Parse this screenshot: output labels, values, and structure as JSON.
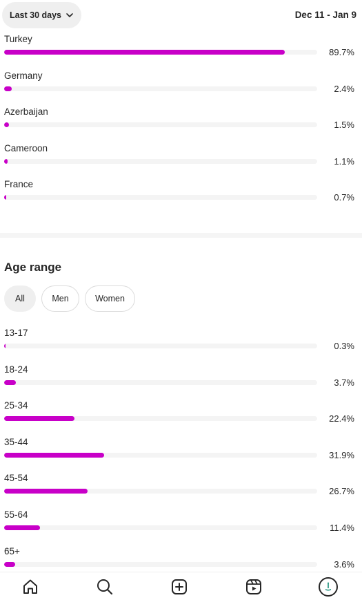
{
  "header": {
    "range_label": "Last 30 days",
    "date_range": "Dec 11 - Jan 9"
  },
  "countries": [
    {
      "label": "Turkey",
      "value": "89.7%",
      "percent": 89.7
    },
    {
      "label": "Germany",
      "value": "2.4%",
      "percent": 2.4
    },
    {
      "label": "Azerbaijan",
      "value": "1.5%",
      "percent": 1.5
    },
    {
      "label": "Cameroon",
      "value": "1.1%",
      "percent": 1.1
    },
    {
      "label": "France",
      "value": "0.7%",
      "percent": 0.7
    }
  ],
  "age_section": {
    "title": "Age range",
    "filters": [
      "All",
      "Men",
      "Women"
    ],
    "selected_filter": "All",
    "rows": [
      {
        "label": "13-17",
        "value": "0.3%",
        "percent": 0.3
      },
      {
        "label": "18-24",
        "value": "3.7%",
        "percent": 3.7
      },
      {
        "label": "25-34",
        "value": "22.4%",
        "percent": 22.4
      },
      {
        "label": "35-44",
        "value": "31.9%",
        "percent": 31.9
      },
      {
        "label": "45-54",
        "value": "26.7%",
        "percent": 26.7
      },
      {
        "label": "55-64",
        "value": "11.4%",
        "percent": 11.4
      },
      {
        "label": "65+",
        "value": "3.6%",
        "percent": 3.6
      }
    ]
  },
  "bottom_nav": {
    "items": [
      "home-icon",
      "search-icon",
      "create-icon",
      "reels-icon",
      "profile-avatar"
    ]
  },
  "colors": {
    "bar_fill": "#c800c8",
    "bar_track": "#f4f4f4",
    "chip_active": "#efefef"
  }
}
